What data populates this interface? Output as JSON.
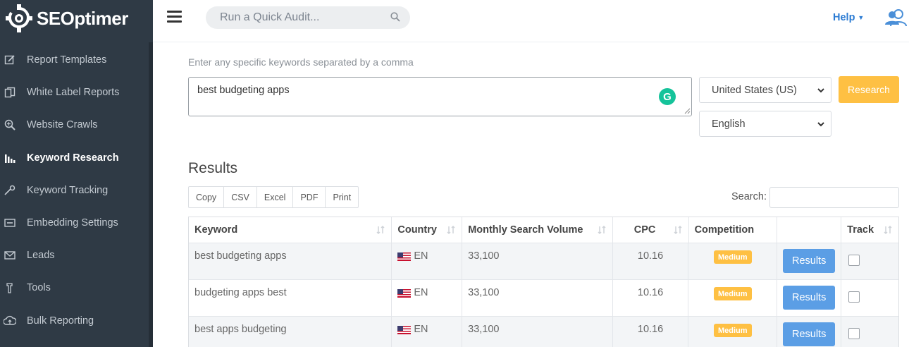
{
  "app": {
    "name": "SEOptimer"
  },
  "sidebar": {
    "items": [
      {
        "label": "Report Templates",
        "icon": "edit-icon",
        "active": false
      },
      {
        "label": "White Label Reports",
        "icon": "documents-icon",
        "active": false
      },
      {
        "label": "Website Crawls",
        "icon": "zoom-icon",
        "active": false
      },
      {
        "label": "Keyword Research",
        "icon": "bar-chart-icon",
        "active": true
      },
      {
        "label": "Keyword Tracking",
        "icon": "tracking-icon",
        "active": false
      },
      {
        "label": "Embedding Settings",
        "icon": "embed-icon",
        "active": false
      },
      {
        "label": "Leads",
        "icon": "envelope-icon",
        "active": false
      },
      {
        "label": "Tools",
        "icon": "tools-icon",
        "active": false
      },
      {
        "label": "Bulk Reporting",
        "icon": "cloud-upload-icon",
        "active": false
      }
    ]
  },
  "topbar": {
    "search_placeholder": "Run a Quick Audit...",
    "help_label": "Help"
  },
  "research": {
    "hint": "Enter any specific keywords separated by a comma",
    "keywords_value": "best budgeting apps",
    "country_selected": "United States (US)",
    "language_selected": "English",
    "research_label": "Research"
  },
  "results": {
    "title": "Results",
    "export_buttons": [
      "Copy",
      "CSV",
      "Excel",
      "PDF",
      "Print"
    ],
    "search_label": "Search:",
    "columns": [
      "Keyword",
      "Country",
      "Monthly Search Volume",
      "CPC",
      "Competition",
      "",
      "Track"
    ],
    "rows": [
      {
        "keyword": "best budgeting apps",
        "country": "EN",
        "volume": "33,100",
        "cpc": "10.16",
        "competition": "Medium",
        "action": "Results"
      },
      {
        "keyword": "budgeting apps best",
        "country": "EN",
        "volume": "33,100",
        "cpc": "10.16",
        "competition": "Medium",
        "action": "Results"
      },
      {
        "keyword": "best apps budgeting",
        "country": "EN",
        "volume": "33,100",
        "cpc": "10.16",
        "competition": "Medium",
        "action": "Results"
      }
    ]
  },
  "colors": {
    "sidebar_bg": "#2f3a45",
    "accent_yellow": "#fec043",
    "button_blue": "#5b9ee5",
    "link_blue": "#2b7bd3"
  }
}
